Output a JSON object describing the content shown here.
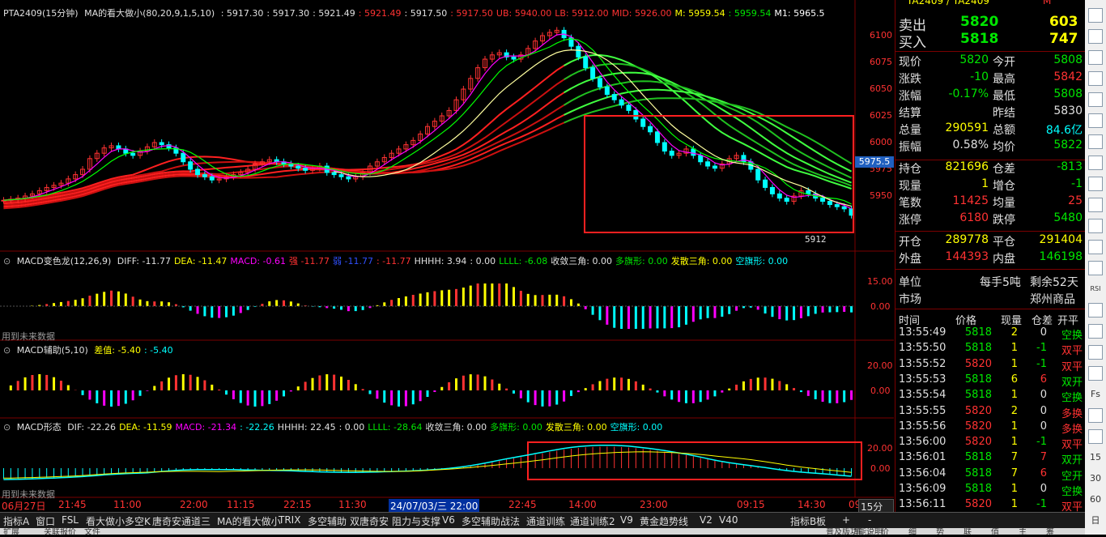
{
  "header": {
    "contract": "PTA2409(15分钟)",
    "ma_label": "MA的看大做小(80,20,9,1,5,10)",
    "values": [
      {
        "text": ": 5917.30",
        "color": "#e0e0e0"
      },
      {
        "text": ": 5917.30",
        "color": "#e0e0e0"
      },
      {
        "text": ": 5921.49",
        "color": "#e0e0e0"
      },
      {
        "text": ": 5921.49",
        "color": "#ff3232"
      },
      {
        "text": ": 5917.50",
        "color": "#e0e0e0"
      },
      {
        "text": ": 5917.50",
        "color": "#ff3232"
      },
      {
        "text": "UB: 5940.00",
        "color": "#ff3232"
      },
      {
        "text": "LB: 5912.00",
        "color": "#ff3232"
      },
      {
        "text": "MID: 5926.00",
        "color": "#ff3232"
      },
      {
        "text": "M: 5959.54",
        "color": "#ffff00"
      },
      {
        "text": ": 5959.54",
        "color": "#00e600"
      },
      {
        "text": "M1: 5965.5",
        "color": "#ffffff"
      }
    ],
    "price_box": "5975.5",
    "low_mark": "5912"
  },
  "price_axis": [
    "6100",
    "6075",
    "6050",
    "6025",
    "6000",
    "5975",
    "5950"
  ],
  "macd1": {
    "title": "MACD变色龙(12,26,9)",
    "items": [
      {
        "text": "DIFF: -11.77",
        "color": "#e0e0e0"
      },
      {
        "text": "DEA: -11.47",
        "color": "#ffff00"
      },
      {
        "text": "MACD: -0.61",
        "color": "#ff00ff"
      },
      {
        "text": "强 -11.77",
        "color": "#ff3232"
      },
      {
        "text": "弱 -11.77",
        "color": "#3050ff"
      },
      {
        "text": ": -11.77",
        "color": "#ff3232"
      },
      {
        "text": "HHHH: 3.94",
        "color": "#e0e0e0"
      },
      {
        "text": ": 0.00",
        "color": "#e0e0e0"
      },
      {
        "text": "LLLL: -6.08",
        "color": "#00e600"
      },
      {
        "text": "收敛三角: 0.00",
        "color": "#e0e0e0"
      },
      {
        "text": "多旗形: 0.00",
        "color": "#00e600"
      },
      {
        "text": "发散三角: 0.00",
        "color": "#ffff00"
      },
      {
        "text": "空旗形: 0.00",
        "color": "#00ffff"
      }
    ],
    "axis": [
      "15.00",
      "0.00"
    ],
    "note": "用到未来数据"
  },
  "macd2": {
    "title": "MACD辅助(5,10)",
    "items": [
      {
        "text": "差值: -5.40",
        "color": "#ffff00"
      },
      {
        "text": ": -5.40",
        "color": "#00ffff"
      }
    ],
    "axis": [
      "20.00",
      "0.00"
    ]
  },
  "macd3": {
    "title": "MACD形态",
    "items": [
      {
        "text": "DIF: -22.26",
        "color": "#e0e0e0"
      },
      {
        "text": "DEA: -11.59",
        "color": "#ffff00"
      },
      {
        "text": "MACD: -21.34",
        "color": "#ff00ff"
      },
      {
        "text": ": -22.26",
        "color": "#00ffff"
      },
      {
        "text": "HHHH: 22.45",
        "color": "#e0e0e0"
      },
      {
        "text": ": 0.00",
        "color": "#e0e0e0"
      },
      {
        "text": "LLLL: -28.64",
        "color": "#00e600"
      },
      {
        "text": "收敛三角: 0.00",
        "color": "#e0e0e0"
      },
      {
        "text": "多旗形: 0.00",
        "color": "#00e600"
      },
      {
        "text": "发散三角: 0.00",
        "color": "#ffff00"
      },
      {
        "text": "空旗形: 0.00",
        "color": "#00ffff"
      }
    ],
    "axis": [
      "20.00",
      "0.00"
    ],
    "note": "用到未来数据"
  },
  "dates": [
    "06月27日",
    "21:45",
    "11:00",
    "22:00",
    "11:15",
    "22:15",
    "11:30",
    "24/07/03/三 22:00",
    "22:45",
    "14:00",
    "23:00",
    "09:15",
    "14:30",
    "09"
  ],
  "period": "15分钟",
  "quote": {
    "title": "TA2409 / TA2409",
    "sell": {
      "label": "卖出",
      "price": "5820",
      "vol": "603"
    },
    "buy": {
      "label": "买入",
      "price": "5818",
      "vol": "747"
    },
    "rows": [
      {
        "l1": "现价",
        "v1": "5820",
        "c1": "#00e600",
        "l2": "今开",
        "v2": "5808",
        "c2": "#00e600"
      },
      {
        "l1": "涨跌",
        "v1": "-10",
        "c1": "#00e600",
        "l2": "最高",
        "v2": "5842",
        "c2": "#ff3232"
      },
      {
        "l1": "涨幅",
        "v1": "-0.17%",
        "c1": "#00e600",
        "l2": "最低",
        "v2": "5808",
        "c2": "#00e600"
      },
      {
        "l1": "结算",
        "v1": "",
        "c1": "#e0e0e0",
        "l2": "昨结",
        "v2": "5830",
        "c2": "#e0e0e0"
      },
      {
        "l1": "总量",
        "v1": "290591",
        "c1": "#ffff00",
        "l2": "总额",
        "v2": "84.6亿",
        "c2": "#00ffff"
      },
      {
        "l1": "振幅",
        "v1": "0.58%",
        "c1": "#e0e0e0",
        "l2": "均价",
        "v2": "5822",
        "c2": "#00e600"
      }
    ],
    "rows2": [
      {
        "l1": "持仓",
        "v1": "821696",
        "c1": "#ffff00",
        "l2": "仓差",
        "v2": "-813",
        "c2": "#00e600"
      },
      {
        "l1": "现量",
        "v1": "1",
        "c1": "#ffff00",
        "l2": "增仓",
        "v2": "-1",
        "c2": "#00e600"
      },
      {
        "l1": "笔数",
        "v1": "11425",
        "c1": "#ff3232",
        "l2": "均量",
        "v2": "25",
        "c2": "#ff3232"
      },
      {
        "l1": "涨停",
        "v1": "6180",
        "c1": "#ff3232",
        "l2": "跌停",
        "v2": "5480",
        "c2": "#00e600"
      }
    ],
    "rows3": [
      {
        "l1": "开仓",
        "v1": "289778",
        "c1": "#ffff00",
        "l2": "平仓",
        "v2": "291404",
        "c2": "#ffff00"
      },
      {
        "l1": "外盘",
        "v1": "144393",
        "c1": "#ff3232",
        "l2": "内盘",
        "v2": "146198",
        "c2": "#00e600"
      }
    ],
    "unit_label": "单位",
    "unit_value": "每手5吨",
    "remain": "剩余52天",
    "market_label": "市场",
    "market_value": "郑州商品"
  },
  "ticks": {
    "headers": [
      "时间",
      "价格",
      "现量",
      "仓差",
      "开平"
    ],
    "rows": [
      [
        "13:55:49",
        "5818",
        "2",
        "0",
        "空换"
      ],
      [
        "13:55:50",
        "5818",
        "1",
        "-1",
        "双平"
      ],
      [
        "13:55:52",
        "5820",
        "1",
        "-1",
        "双平"
      ],
      [
        "13:55:53",
        "5818",
        "6",
        "6",
        "双开"
      ],
      [
        "13:55:54",
        "5818",
        "1",
        "0",
        "空换"
      ],
      [
        "13:55:55",
        "5820",
        "2",
        "0",
        "多换"
      ],
      [
        "13:55:56",
        "5820",
        "1",
        "0",
        "多换"
      ],
      [
        "13:56:00",
        "5820",
        "1",
        "-1",
        "双平"
      ],
      [
        "13:56:01",
        "5818",
        "7",
        "7",
        "双开"
      ],
      [
        "13:56:04",
        "5818",
        "7",
        "6",
        "空开"
      ],
      [
        "13:56:09",
        "5818",
        "1",
        "0",
        "空换"
      ],
      [
        "13:56:11",
        "5820",
        "1",
        "-1",
        "双平"
      ]
    ]
  },
  "bottom_tabs": [
    "指标A",
    "窗口",
    "FSL",
    "看大做小多空K",
    "唐奇安通道三",
    "MA的看大做小",
    "TRIX",
    "多空辅助",
    "双唐奇安",
    "阻力与支撑",
    "V6",
    "多空辅助战法",
    "通道训练",
    "通道训练2",
    "V9",
    "黄金趋势线",
    "V2",
    "V40",
    "指标B",
    "板",
    "+",
    "-"
  ],
  "bottom_strip": [
    "扩展",
    "关联报价",
    "文件",
    "普及版功能说明",
    "笔",
    "价",
    "细",
    "势",
    "联",
    "值",
    "主",
    "筹"
  ],
  "right_icons": [
    "up-arrow",
    "m-chart",
    "bar-chart",
    "line-chart",
    "grid",
    "candle",
    "grid2",
    "window",
    "fx",
    "search",
    "box",
    "chart",
    "grid3",
    "RSI",
    "dollar",
    "dice",
    "pencil",
    "book",
    "Fs",
    "win",
    "grid4",
    "15",
    "30",
    "60",
    "日"
  ],
  "price_series": [
    5946,
    5947,
    5948,
    5950,
    5952,
    5955,
    5958,
    5960,
    5962,
    5966,
    5970,
    5975,
    5985,
    5990,
    5995,
    5997,
    5994,
    5990,
    5988,
    5992,
    5996,
    6000,
    5998,
    5995,
    5990,
    5982,
    5975,
    5970,
    5968,
    5965,
    5966,
    5968,
    5970,
    5972,
    5975,
    5980,
    5982,
    5984,
    5982,
    5980,
    5978,
    5976,
    5974,
    5976,
    5978,
    5972,
    5970,
    5968,
    5966,
    5968,
    5972,
    5978,
    5982,
    5986,
    5990,
    5994,
    5998,
    6002,
    6008,
    6015,
    6020,
    6025,
    6030,
    6040,
    6050,
    6060,
    6070,
    6078,
    6082,
    6084,
    6080,
    6078,
    6082,
    6088,
    6095,
    6100,
    6103,
    6105,
    6098,
    6090,
    6080,
    6070,
    6060,
    6052,
    6045,
    6040,
    6035,
    6030,
    6022,
    6015,
    6010,
    6000,
    5992,
    5988,
    5990,
    5994,
    5988,
    5982,
    5978,
    5976,
    5980,
    5985,
    5988,
    5982,
    5975,
    5965,
    5958,
    5952,
    5948,
    5945,
    5950,
    5955,
    5952,
    5948,
    5945,
    5942,
    5940,
    5938,
    5932
  ]
}
